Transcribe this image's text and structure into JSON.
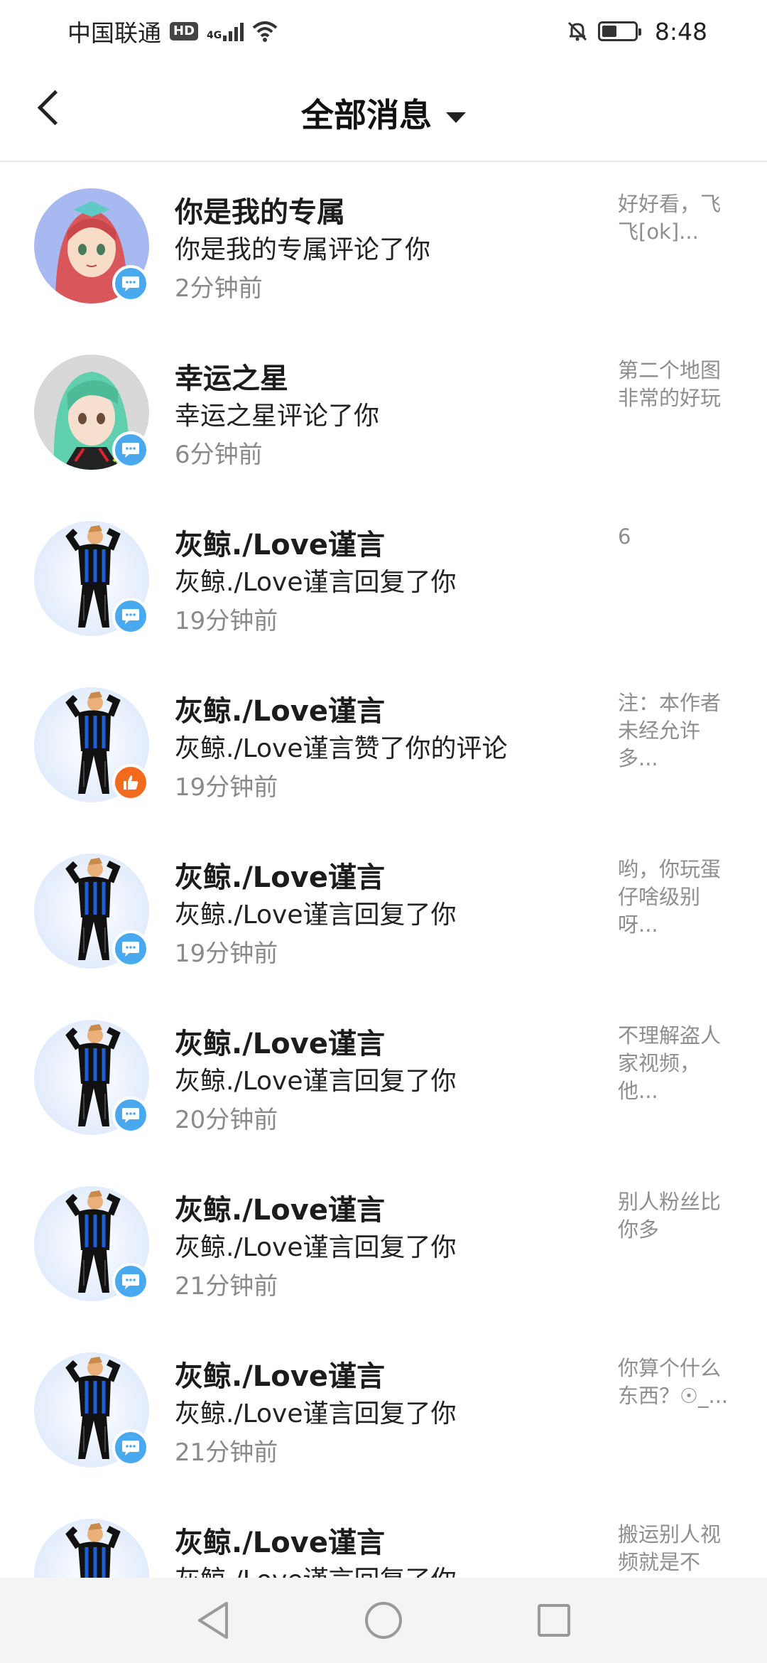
{
  "status_bar": {
    "carrier": "中国联通",
    "hd": "HD",
    "network": "4G",
    "time": "8:48",
    "battery_level": 0.45
  },
  "header": {
    "title": "全部消息",
    "back_icon": "chevron-left-icon",
    "dropdown_icon": "caret-down-icon"
  },
  "colors": {
    "comment_badge": "#4aa8ef",
    "like_badge": "#f26b1d"
  },
  "messages": [
    {
      "avatar": "anime-girl-red-hair",
      "name": "你是我的专属",
      "action": "你是我的专属评论了你",
      "time": "2分钟前",
      "preview": "好好看，飞\n飞[ok]...",
      "badge": "comment-icon"
    },
    {
      "avatar": "anime-girl-green-hair",
      "name": "幸运之星",
      "action": "幸运之星评论了你",
      "time": "6分钟前",
      "preview": "第二个地图\n非常的好玩",
      "badge": "comment-icon"
    },
    {
      "avatar": "anime-boy-character",
      "name": "灰鲸./Love谨言",
      "action": "灰鲸./Love谨言回复了你",
      "time": "19分钟前",
      "preview": "6",
      "badge": "comment-icon"
    },
    {
      "avatar": "anime-boy-character",
      "name": "灰鲸./Love谨言",
      "action": "灰鲸./Love谨言赞了你的评论",
      "time": "19分钟前",
      "preview": "注：本作者\n未经允许\n多...",
      "badge": "thumbs-up-icon"
    },
    {
      "avatar": "anime-boy-character",
      "name": "灰鲸./Love谨言",
      "action": "灰鲸./Love谨言回复了你",
      "time": "19分钟前",
      "preview": "哟，你玩蛋\n仔啥级别\n呀...",
      "badge": "comment-icon"
    },
    {
      "avatar": "anime-boy-character",
      "name": "灰鲸./Love谨言",
      "action": "灰鲸./Love谨言回复了你",
      "time": "20分钟前",
      "preview": "不理解盗人\n家视频，\n他...",
      "badge": "comment-icon"
    },
    {
      "avatar": "anime-boy-character",
      "name": "灰鲸./Love谨言",
      "action": "灰鲸./Love谨言回复了你",
      "time": "21分钟前",
      "preview": "别人粉丝比\n你多",
      "badge": "comment-icon"
    },
    {
      "avatar": "anime-boy-character",
      "name": "灰鲸./Love谨言",
      "action": "灰鲸./Love谨言回复了你",
      "time": "21分钟前",
      "preview": "你算个什么\n东西？☉_...",
      "badge": "comment-icon"
    },
    {
      "avatar": "anime-boy-character",
      "name": "灰鲸./Love谨言",
      "action": "灰鲸./Love谨言回复了你",
      "time": "",
      "preview": "搬运别人视\n频就是不",
      "badge": "comment-icon"
    }
  ],
  "nav": {
    "back": "triangle-back-icon",
    "home": "circle-home-icon",
    "recents": "square-recents-icon"
  }
}
